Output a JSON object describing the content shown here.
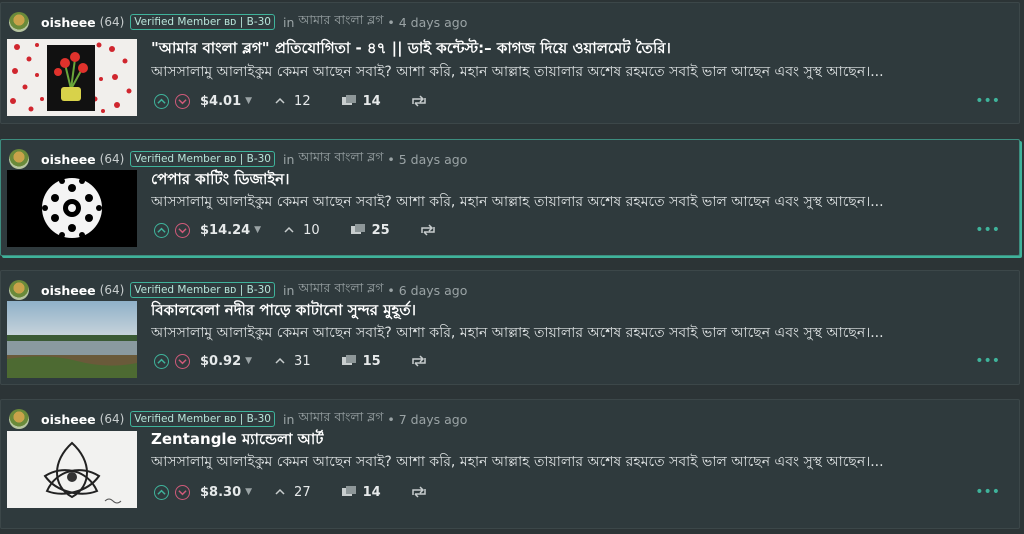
{
  "posts": [
    {
      "author": "oisheee",
      "rep": "(64)",
      "badge": "Verified Member ʙᴅ | B-30",
      "in": "in",
      "community": "আমার বাংলা ব্লগ",
      "time": "• 4 days ago",
      "title": "\"আমার বাংলা ব্লগ\" প্রতিযোগিতা - ৪৭ || ডাই কন্টেস্ট:– কাগজ দিয়ে ওয়ালমেট তৈরি।",
      "summary": "আসসালামু আলাইকুম কেমন আছেন সবাই? আশা করি, মহান আল্লাহ তায়ালার অশেষ রহমতে সবাই ভাল আছেন এবং সুস্থ আছেন।...",
      "payout": "$4.01",
      "votes": "12",
      "comments": "14",
      "thumb": "flowers-on-red-dots"
    },
    {
      "author": "oisheee",
      "rep": "(64)",
      "badge": "Verified Member ʙᴅ | B-30",
      "in": "in",
      "community": "আমার বাংলা ব্লগ",
      "time": "• 5 days ago",
      "title": "পেপার কাটিং ডিজাইন।",
      "summary": "আসসালামু আলাইকুম কেমন আছেন সবাই? আশা করি, মহান আল্লাহ তায়ালার অশেষ রহমতে সবাই ভাল আছেন এবং সুস্থ আছেন।...",
      "payout": "$14.24",
      "votes": "10",
      "comments": "25",
      "thumb": "paper-snowflake"
    },
    {
      "author": "oisheee",
      "rep": "(64)",
      "badge": "Verified Member ʙᴅ | B-30",
      "in": "in",
      "community": "আমার বাংলা ব্লগ",
      "time": "• 6 days ago",
      "title": "বিকালবেলা নদীর পাড়ে কাটানো সুন্দর মুহূর্ত।",
      "summary": "আসসালামু আলাইকুম কেমন আছেন সবাই? আশা করি, মহান আল্লাহ তায়ালার অশেষ রহমতে সবাই ভাল আছেন এবং সুস্থ আছেন।...",
      "payout": "$0.92",
      "votes": "31",
      "comments": "15",
      "thumb": "river-landscape"
    },
    {
      "author": "oisheee",
      "rep": "(64)",
      "badge": "Verified Member ʙᴅ | B-30",
      "in": "in",
      "community": "আমার বাংলা ব্লগ",
      "time": "• 7 days ago",
      "title": "Zentangle ম্যান্ডেলা আর্ট",
      "summary": "আসসালামু আলাইকুম কেমন আছেন সবাই? আশা করি, মহান আল্লাহ তায়ালার অশেষ রহমতে সবাই ভাল আছেন এবং সুস্থ আছেন।...",
      "payout": "$8.30",
      "votes": "27",
      "comments": "14",
      "thumb": "zentangle-drawing"
    }
  ],
  "colors": {
    "background": "#2c3436",
    "card": "#2f3a3d",
    "accent": "#3fb39b",
    "downvote": "#d05a7a"
  },
  "icons": [
    "upvote-icon",
    "downvote-icon",
    "caret-down-icon",
    "chevron-up-icon",
    "comments-icon",
    "reblog-icon",
    "more-icon"
  ]
}
